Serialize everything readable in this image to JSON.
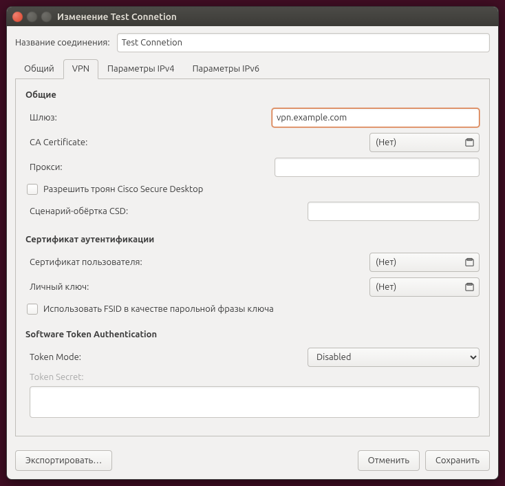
{
  "window": {
    "title": "Изменение Test Connetion"
  },
  "name_row": {
    "label": "Название соединения:",
    "value": "Test Connetion"
  },
  "tabs": [
    {
      "label": "Общий",
      "active": false
    },
    {
      "label": "VPN",
      "active": true
    },
    {
      "label": "Параметры IPv4",
      "active": false
    },
    {
      "label": "Параметры IPv6",
      "active": false
    }
  ],
  "vpn": {
    "general": {
      "title": "Общие",
      "gateway_label": "Шлюз:",
      "gateway_value": "vpn.example.com",
      "ca_cert_label": "CA Certificate:",
      "ca_cert_value": "(Нет)",
      "proxy_label": "Прокси:",
      "proxy_value": "",
      "csd_checkbox_label": "Разрешить троян Cisco Secure Desktop",
      "csd_wrapper_label": "Сценарий-обёртка CSD:",
      "csd_wrapper_value": ""
    },
    "auth": {
      "title": "Сертификат аутентификации",
      "user_cert_label": "Сертификат пользователя:",
      "user_cert_value": "(Нет)",
      "private_key_label": "Личный ключ:",
      "private_key_value": "(Нет)",
      "fsid_checkbox_label": "Использовать FSID в качестве парольной фразы ключа"
    },
    "token": {
      "title": "Software Token Authentication",
      "mode_label": "Token Mode:",
      "mode_value": "Disabled",
      "secret_label": "Token Secret:",
      "secret_value": ""
    }
  },
  "footer": {
    "export_label": "Экспортировать…",
    "cancel_label": "Отменить",
    "save_label": "Сохранить"
  }
}
